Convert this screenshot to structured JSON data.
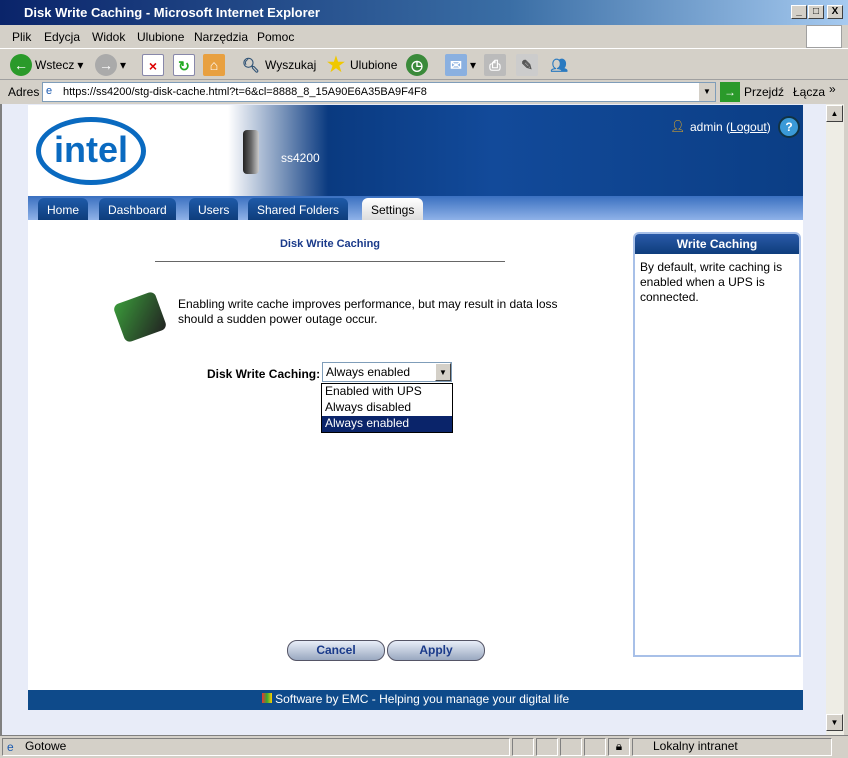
{
  "window": {
    "title": "Disk Write Caching - Microsoft Internet Explorer",
    "min": "_",
    "max": "□",
    "close": "X"
  },
  "menu": [
    "Plik",
    "Edycja",
    "Widok",
    "Ulubione",
    "Narzędzia",
    "Pomoc"
  ],
  "toolbar": {
    "back": "Wstecz",
    "search": "Wyszukaj",
    "favorites": "Ulubione"
  },
  "address": {
    "label": "Adres",
    "url": "https://ss4200/stg-disk-cache.html?t=6&cl=8888_8_15A90E6A35BA9F4F8",
    "go": "Przejdź",
    "links": "Łącza"
  },
  "header": {
    "logo": "intel",
    "device": "ss4200",
    "user": "admin",
    "logout": "Logout"
  },
  "tabs": [
    "Home",
    "Dashboard",
    "Users",
    "Shared Folders",
    "Settings"
  ],
  "main": {
    "title": "Disk Write Caching",
    "description": "Enabling write cache improves performance, but may result in data loss should a sudden power outage occur.",
    "field_label": "Disk Write Caching:",
    "selected": "Always enabled",
    "options": [
      "Enabled with UPS",
      "Always disabled",
      "Always enabled"
    ],
    "cancel": "Cancel",
    "apply": "Apply"
  },
  "help": {
    "title": "Write Caching",
    "text": "By default, write caching is enabled when a UPS is connected."
  },
  "footer": "Software by EMC - Helping you manage your digital life",
  "status": {
    "text": "Gotowe",
    "zone": "Lokalny intranet"
  }
}
